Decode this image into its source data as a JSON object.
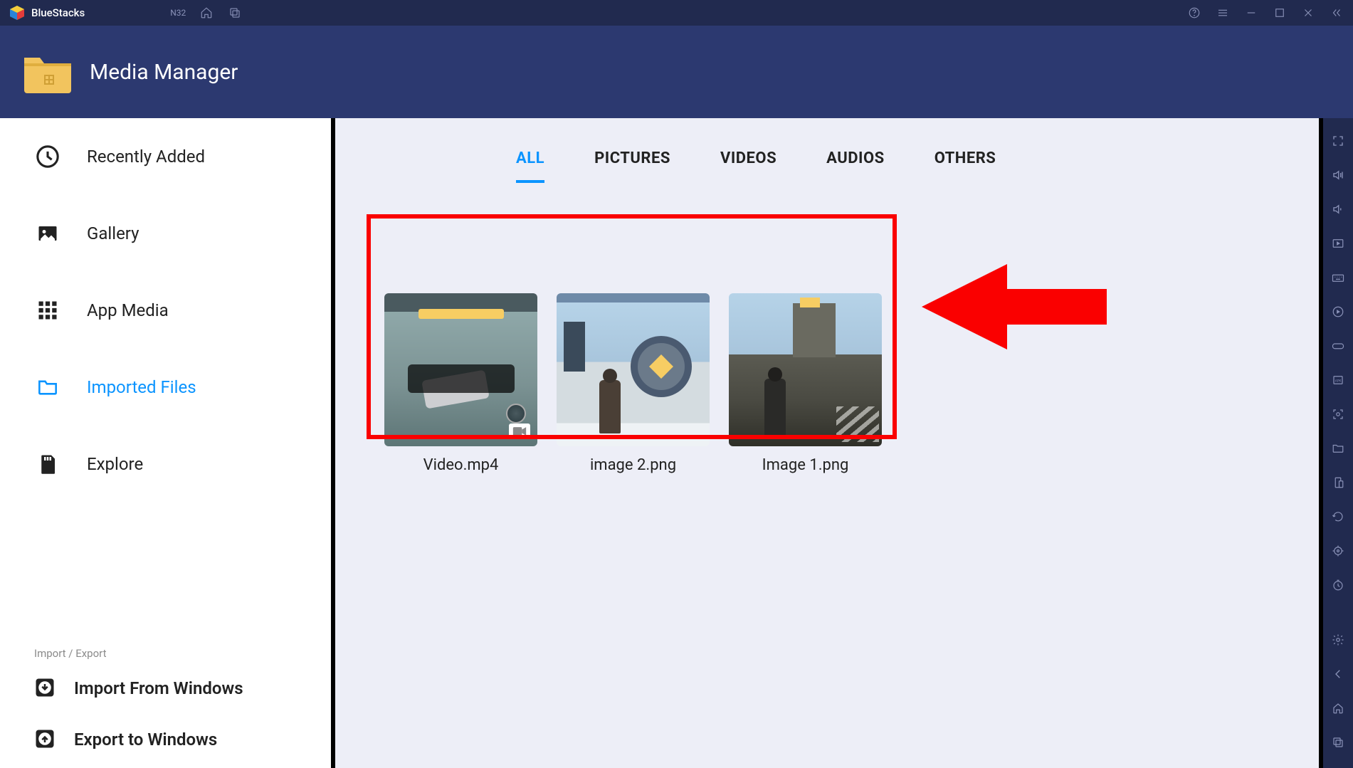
{
  "titlebar": {
    "brand": "BlueStacks",
    "badge": "N32"
  },
  "header": {
    "title": "Media Manager"
  },
  "sidebar": {
    "items": [
      {
        "label": "Recently Added",
        "icon": "clock"
      },
      {
        "label": "Gallery",
        "icon": "image"
      },
      {
        "label": "App Media",
        "icon": "grid"
      },
      {
        "label": "Imported Files",
        "icon": "folder",
        "active": true
      },
      {
        "label": "Explore",
        "icon": "sd-card"
      }
    ],
    "group_label": "Import / Export",
    "actions": [
      {
        "label": "Import From Windows",
        "icon": "import"
      },
      {
        "label": "Export to Windows",
        "icon": "export"
      }
    ]
  },
  "tabs": [
    {
      "label": "ALL",
      "active": true
    },
    {
      "label": "PICTURES"
    },
    {
      "label": "VIDEOS"
    },
    {
      "label": "AUDIOS"
    },
    {
      "label": "OTHERS"
    }
  ],
  "files": [
    {
      "name": "Video.mp4",
      "type": "video"
    },
    {
      "name": "image 2.png",
      "type": "image"
    },
    {
      "name": "Image 1.png",
      "type": "image"
    }
  ]
}
